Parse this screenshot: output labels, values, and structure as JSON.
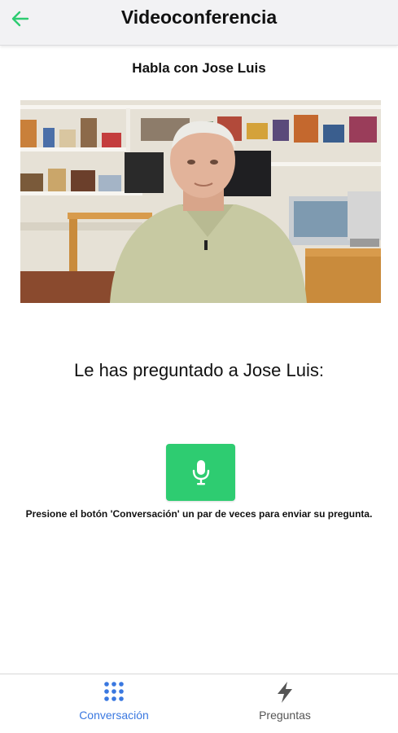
{
  "header": {
    "title": "Videoconferencia",
    "back_icon": "arrow-left-icon",
    "accent": "#2ecc71"
  },
  "subtitle": "Habla con Jose Luis",
  "question_label": "Le has preguntado a Jose Luis:",
  "mic_button": {
    "icon": "microphone-icon",
    "color": "#2ecc71"
  },
  "instructions": "Presione el botón 'Conversación' un par de veces para enviar su pregunta.",
  "bottom_nav": {
    "tabs": [
      {
        "label": "Conversación",
        "icon": "grid-dots-icon",
        "active": true,
        "color": "#3a78e0"
      },
      {
        "label": "Preguntas",
        "icon": "lightning-icon",
        "active": false,
        "color": "#555555"
      }
    ]
  }
}
